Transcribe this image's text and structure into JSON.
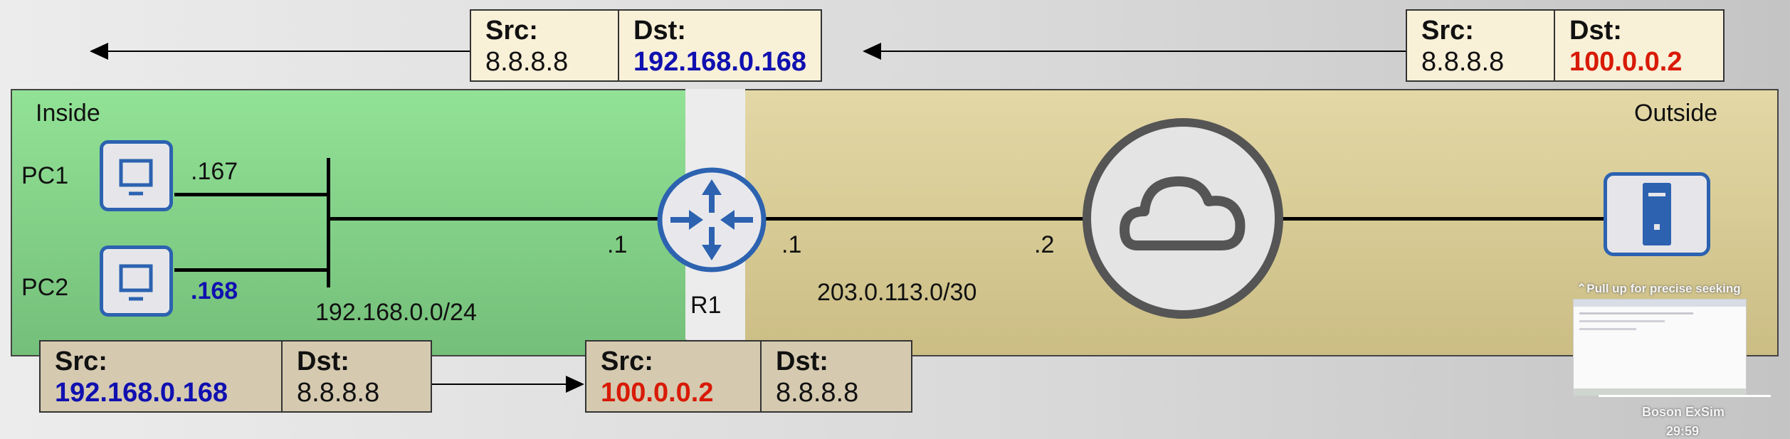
{
  "zones": {
    "inside": "Inside",
    "outside": "Outside"
  },
  "devices": {
    "pc1": "PC1",
    "pc2": "PC2",
    "router": "R1"
  },
  "addresses": {
    "pc1_host": ".167",
    "pc2_host": ".168",
    "inside_network": "192.168.0.0/24",
    "r1_inside": ".1",
    "r1_outside": ".1",
    "isp_side": ".2",
    "outside_network": "203.0.113.0/30"
  },
  "packets": {
    "top_inside": {
      "src_label": "Src:",
      "src": "8.8.8.8",
      "dst_label": "Dst:",
      "dst": "192.168.0.168"
    },
    "top_outside": {
      "src_label": "Src:",
      "src": "8.8.8.8",
      "dst_label": "Dst:",
      "dst": "100.0.0.2"
    },
    "bottom_inside": {
      "src_label": "Src:",
      "src": "192.168.0.168",
      "dst_label": "Dst:",
      "dst": "8.8.8.8"
    },
    "bottom_outside": {
      "src_label": "Src:",
      "src": "100.0.0.2",
      "dst_label": "Dst:",
      "dst": "8.8.8.8"
    }
  },
  "video_overlay": {
    "seek_hint": "Pull up for precise seeking",
    "chapter": "Boson ExSim",
    "time": "29:59"
  },
  "colors": {
    "inside_highlight": "#1010b0",
    "nat_highlight": "#d81a06",
    "icon_blue": "#2c62b0"
  }
}
